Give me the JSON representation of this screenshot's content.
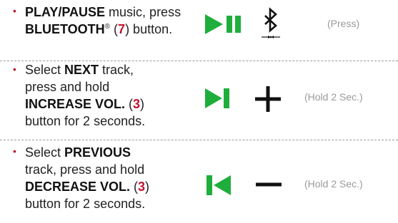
{
  "colors": {
    "accent_red": "#c4122f",
    "icon_green": "#1fae3c",
    "text_dark": "#222222",
    "note_gray": "#9a9a9a"
  },
  "rows": [
    {
      "lines": [
        {
          "parts": [
            {
              "t": "PLAY/PAUSE",
              "s": "b"
            },
            {
              "t": " music, press",
              "s": "n"
            }
          ]
        },
        {
          "parts": [
            {
              "t": "BLUETOOTH",
              "s": "b"
            },
            {
              "t": "®",
              "s": "sup"
            },
            {
              "t": " (",
              "s": "n"
            },
            {
              "t": "7",
              "s": "red"
            },
            {
              "t": ") button.",
              "s": "n"
            }
          ]
        }
      ],
      "icons": [
        "play-pause-icon",
        "bluetooth-icon"
      ],
      "note": "(Press)"
    },
    {
      "lines": [
        {
          "parts": [
            {
              "t": "Select ",
              "s": "n"
            },
            {
              "t": "NEXT",
              "s": "b"
            },
            {
              "t": " track,",
              "s": "n"
            }
          ]
        },
        {
          "parts": [
            {
              "t": "press and hold",
              "s": "n"
            }
          ]
        },
        {
          "parts": [
            {
              "t": "INCREASE VOL.",
              "s": "b"
            },
            {
              "t": " (",
              "s": "n"
            },
            {
              "t": "3",
              "s": "red"
            },
            {
              "t": ")",
              "s": "n"
            }
          ]
        },
        {
          "parts": [
            {
              "t": "button for 2 seconds.",
              "s": "n"
            }
          ]
        }
      ],
      "icons": [
        "next-track-icon",
        "plus-icon"
      ],
      "note": "(Hold 2 Sec.)"
    },
    {
      "lines": [
        {
          "parts": [
            {
              "t": "Select ",
              "s": "n"
            },
            {
              "t": "PREVIOUS",
              "s": "b"
            }
          ]
        },
        {
          "parts": [
            {
              "t": "track, press and hold",
              "s": "n"
            }
          ]
        },
        {
          "parts": [
            {
              "t": "DECREASE VOL.",
              "s": "b"
            },
            {
              "t": " (",
              "s": "n"
            },
            {
              "t": "3",
              "s": "red"
            },
            {
              "t": ")",
              "s": "n"
            }
          ]
        },
        {
          "parts": [
            {
              "t": "button for 2 seconds.",
              "s": "n"
            }
          ]
        }
      ],
      "icons": [
        "previous-track-icon",
        "minus-icon"
      ],
      "note": "(Hold 2 Sec.)"
    }
  ]
}
